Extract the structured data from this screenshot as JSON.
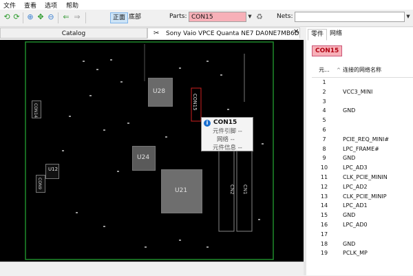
{
  "menu": {
    "items": [
      "文件",
      "查看",
      "选项",
      "帮助"
    ]
  },
  "toolbar": {
    "view_tabs": [
      "正面",
      "底部"
    ],
    "parts_label": "Parts:",
    "parts_value": "CON15",
    "nets_label": "Nets:",
    "nets_value": ""
  },
  "doc_tabs": {
    "catalog": "Catalog",
    "board": "Sony Vaio VPCE Quanta NE7 DA0NE7MB6D..."
  },
  "board": {
    "chip_labels": [
      "U28",
      "U24",
      "U21",
      "CN2",
      "CN1",
      "CON15",
      "U12",
      "CON14",
      "CON9"
    ]
  },
  "tooltip": {
    "title": "CON15",
    "lines": [
      "元件引脚 --",
      "网络 --",
      "元件信息 --"
    ]
  },
  "panel": {
    "tabs": [
      "零件",
      "网络"
    ],
    "selected_part": "CON15",
    "columns": [
      "元...",
      "连接的网络名称"
    ],
    "rows": [
      {
        "n": "1",
        "net": ""
      },
      {
        "n": "2",
        "net": "VCC3_MINI"
      },
      {
        "n": "3",
        "net": ""
      },
      {
        "n": "4",
        "net": "GND"
      },
      {
        "n": "5",
        "net": ""
      },
      {
        "n": "6",
        "net": ""
      },
      {
        "n": "7",
        "net": "PCIE_REQ_MINI#"
      },
      {
        "n": "8",
        "net": "LPC_FRAME#"
      },
      {
        "n": "9",
        "net": "GND"
      },
      {
        "n": "10",
        "net": "LPC_AD3"
      },
      {
        "n": "11",
        "net": "CLK_PCIE_MININ"
      },
      {
        "n": "12",
        "net": "LPC_AD2"
      },
      {
        "n": "13",
        "net": "CLK_PCIE_MINIP"
      },
      {
        "n": "14",
        "net": "LPC_AD1"
      },
      {
        "n": "15",
        "net": "GND"
      },
      {
        "n": "16",
        "net": "LPC_AD0"
      },
      {
        "n": "17",
        "net": ""
      },
      {
        "n": "18",
        "net": "GND"
      },
      {
        "n": "19",
        "net": "PCLK_MP"
      }
    ]
  },
  "colors": {
    "highlight": "#f7b0b8",
    "accent_red": "#b00010",
    "board_bg": "#000000",
    "info_blue": "#1a6fd0"
  }
}
